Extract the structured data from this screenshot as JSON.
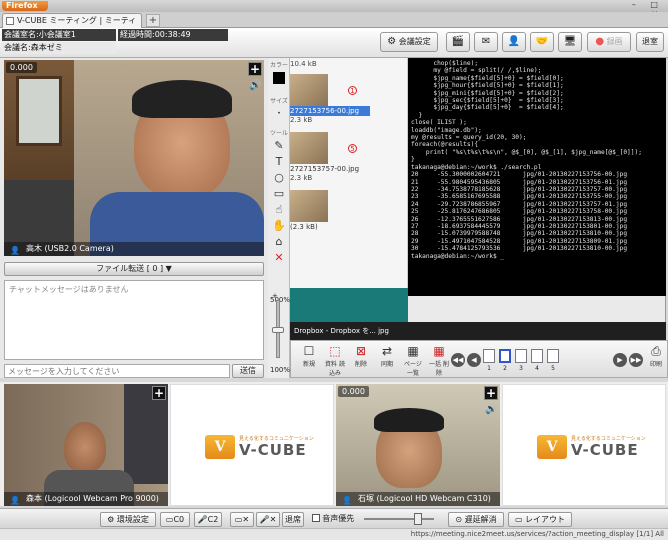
{
  "browser": {
    "menu_label": "Firefox",
    "tab_title": "V-CUBE ミーティング | ミーティング",
    "window_controls": "– □ ×"
  },
  "header": {
    "room_name": "会議室名:小会議室1",
    "elapsed": "経過時間:00:38:49",
    "owner": "会議名:森本ゼミ",
    "settings_label": "会議設定",
    "record_label": "録画",
    "exit_label": "退室"
  },
  "main_video": {
    "count": "0.000",
    "label": "高木 (USB2.0 Camera)"
  },
  "file_transfer": {
    "label": "ファイル転送 [ 0 ]"
  },
  "chat": {
    "empty_message": "チャットメッセージはありません",
    "input_placeholder": "メッセージを入力してください",
    "send_label": "送信"
  },
  "tools": {
    "color_label": "カラー",
    "size_label": "サイズ",
    "tool_label": "ツール",
    "zoom_top": "500%",
    "zoom_bottom": "100%"
  },
  "document": {
    "thumbs": [
      {
        "size": "10.4 kB",
        "badge": "1",
        "name": "2727153756-00.jpg",
        "size2": "2.3 kB"
      },
      {
        "size": "",
        "badge": "5",
        "name": "2727153757-00.jpg",
        "size2": "2.3 kB"
      },
      {
        "size": "",
        "badge": "",
        "name": "(2.3 kB)",
        "size2": ""
      }
    ],
    "terminal_lines": [
      "      chop($line);",
      "      my @field = split(/ /,$line);",
      "      $jpg_name{$field[5]+0} = $field[0];",
      "      $jpg_hour{$field[5]+0} = $field[1];",
      "      $jpg_mini{$field[5]+0} = $field[2];",
      "      $jpg_sec{$field[5]+0}  = $field[3];",
      "      $jpg_day{$field[5]+0}  = $field[4];",
      "  }",
      "close( ILIST );",
      "",
      "loaddb(\"image.db\");",
      "",
      "my @results = query_id(20, 30);",
      "",
      "foreach(@results){",
      "    print( \"%s\\t%s\\t%s\\n\", @$_[0], @$_[1], $jpg_name[@$_[0]]);",
      "}",
      "",
      "takanaga@debian:~/work$ ./search.pl",
      "20     -55.3000002604721      jpg/01-20130227153756-00.jpg",
      "21     -55.9804595436805      jpg/01-20130227153756-01.jpg",
      "22     -34.7538778185628      jpg/01-20130227153757-00.jpg",
      "23     -35.6585167695588      jpg/01-20130227153755-00.jpg",
      "24     -29.7238786855967      jpg/01-20130227153757-01.jpg",
      "25     -25.8176247686805      jpg/01-20130227153758-00.jpg",
      "26     -12.3765551627586      jpg/01-20130227153813-00.jpg",
      "27     -18.6937584445579      jpg/01-20130227153801-00.jpg",
      "28     -15.0739979588748      jpg/01-20130227153810-00.jpg",
      "29     -15.4971047584528      jpg/01-20130227153809-01.jpg",
      "30     -15.4784125793536      jpg/01-20130227153810-00.jpg",
      "takanaga@debian:~/work$ _"
    ],
    "taskbar": "Dropbox - Dropbox を...      jpg"
  },
  "doc_toolbar": {
    "buttons": [
      "新規",
      "資料\n読込み",
      "削除",
      "同期",
      "ページ\n一覧",
      "一括\n削除"
    ],
    "pages": [
      "1",
      "2",
      "3",
      "4",
      "5"
    ],
    "print_label": "印刷"
  },
  "videos": [
    {
      "label": "森本 (Logicool Webcam Pro 9000)"
    },
    {
      "label": "石塚 (Logicool HD Webcam C310)",
      "count": "0.000"
    }
  ],
  "vcube": {
    "name": "V-CUBE",
    "tagline": "見える化するコミュニケーション"
  },
  "bottom_bar": {
    "env_settings": "環境設定",
    "cam": "C0",
    "mic": "C2",
    "mute_cam": "",
    "mute_mic": "",
    "leave": "退席",
    "audio_priority": "音声優先",
    "delay_release": "遅延解消",
    "layout": "レイアウト"
  },
  "status": {
    "url": "https://meeting.nice2meet.us/services/?action_meeting_display [1/1] All"
  },
  "colors": {
    "header_dark": "#3a3a3a",
    "terminal_bg": "#000000",
    "teal": "#1a7a78",
    "vcube_orange": "#f0a020"
  }
}
